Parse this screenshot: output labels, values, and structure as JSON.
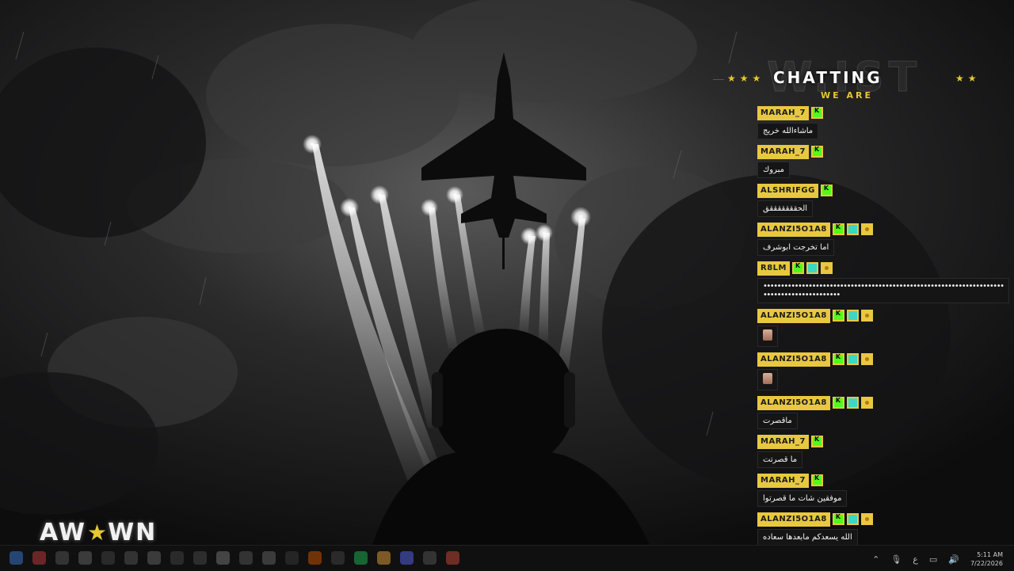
{
  "overlay": {
    "logo": {
      "left": "AW",
      "right": "WN"
    },
    "chat": {
      "title": "CHATTING",
      "subtitle": "WE ARE",
      "messages": [
        {
          "user": "MARAH_7",
          "badges": [
            "kick"
          ],
          "text": "ماشاءالله خريج"
        },
        {
          "user": "MARAH_7",
          "badges": [
            "kick"
          ],
          "text": "مبروك"
        },
        {
          "user": "ALSHRIFGG",
          "badges": [
            "kick"
          ],
          "text": "الحقققققققق"
        },
        {
          "user": "ALANZI5O1A8",
          "badges": [
            "kick",
            "sub",
            "gift"
          ],
          "text": "اما تخرجت ابوشرف"
        },
        {
          "user": "R8LM",
          "badges": [
            "kick",
            "sub",
            "gift"
          ],
          "text": "•••••••••••••••••••••••••••••••••••••••••••••••••••••••••••••••••••••••••••••••••••••••••••"
        },
        {
          "user": "ALANZI5O1A8",
          "badges": [
            "kick",
            "sub",
            "gift"
          ],
          "text": ""
        },
        {
          "user": "ALANZI5O1A8",
          "badges": [
            "kick",
            "sub",
            "gift"
          ],
          "text": ""
        },
        {
          "user": "ALANZI5O1A8",
          "badges": [
            "kick",
            "sub",
            "gift"
          ],
          "text": "ماقصرت"
        },
        {
          "user": "MARAH_7",
          "badges": [
            "kick"
          ],
          "text": "ما قصرتت"
        },
        {
          "user": "MARAH_7",
          "badges": [
            "kick"
          ],
          "text": "موفقين شات ما قصرتوا"
        },
        {
          "user": "ALANZI5O1A8",
          "badges": [
            "kick",
            "sub",
            "gift"
          ],
          "text": "الله يسعدكم مابعدها سعاده"
        }
      ]
    }
  },
  "taskbar": {
    "tray": {
      "lang": "ع",
      "time": "5:11 AM",
      "date": "7/22/2026"
    }
  },
  "colors": {
    "accent": "#e8c840",
    "kick_green": "#53fc18"
  }
}
